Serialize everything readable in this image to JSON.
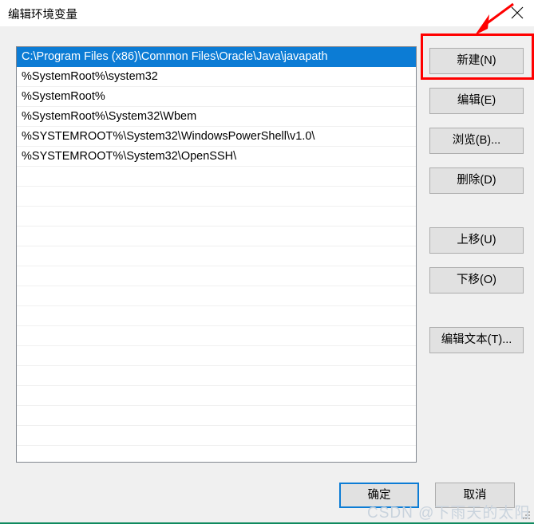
{
  "window": {
    "title": "编辑环境变量",
    "close_icon": "close-icon"
  },
  "path_list": {
    "selected_index": 0,
    "items": [
      "C:\\Program Files (x86)\\Common Files\\Oracle\\Java\\javapath",
      "%SystemRoot%\\system32",
      "%SystemRoot%",
      "%SystemRoot%\\System32\\Wbem",
      "%SYSTEMROOT%\\System32\\WindowsPowerShell\\v1.0\\",
      "%SYSTEMROOT%\\System32\\OpenSSH\\"
    ]
  },
  "side_buttons": {
    "new": "新建(N)",
    "edit": "编辑(E)",
    "browse": "浏览(B)...",
    "delete": "删除(D)",
    "move_up": "上移(U)",
    "move_down": "下移(O)",
    "edit_text": "编辑文本(T)..."
  },
  "bottom_buttons": {
    "ok": "确定",
    "cancel": "取消"
  },
  "annotations": {
    "highlight_color": "#ff0000",
    "arrow_color": "#ff0000",
    "highlight_target": "新建(N)"
  },
  "watermark": {
    "text": "CSDN @下雨天的太阳",
    "color": "#c9d3dd"
  },
  "colors": {
    "selection_blue": "#0c7cd5",
    "default_button_border": "#0c7cd5",
    "dialog_background": "#f0f0f0",
    "button_face": "#e1e1e1",
    "listbox_border": "#828790"
  }
}
